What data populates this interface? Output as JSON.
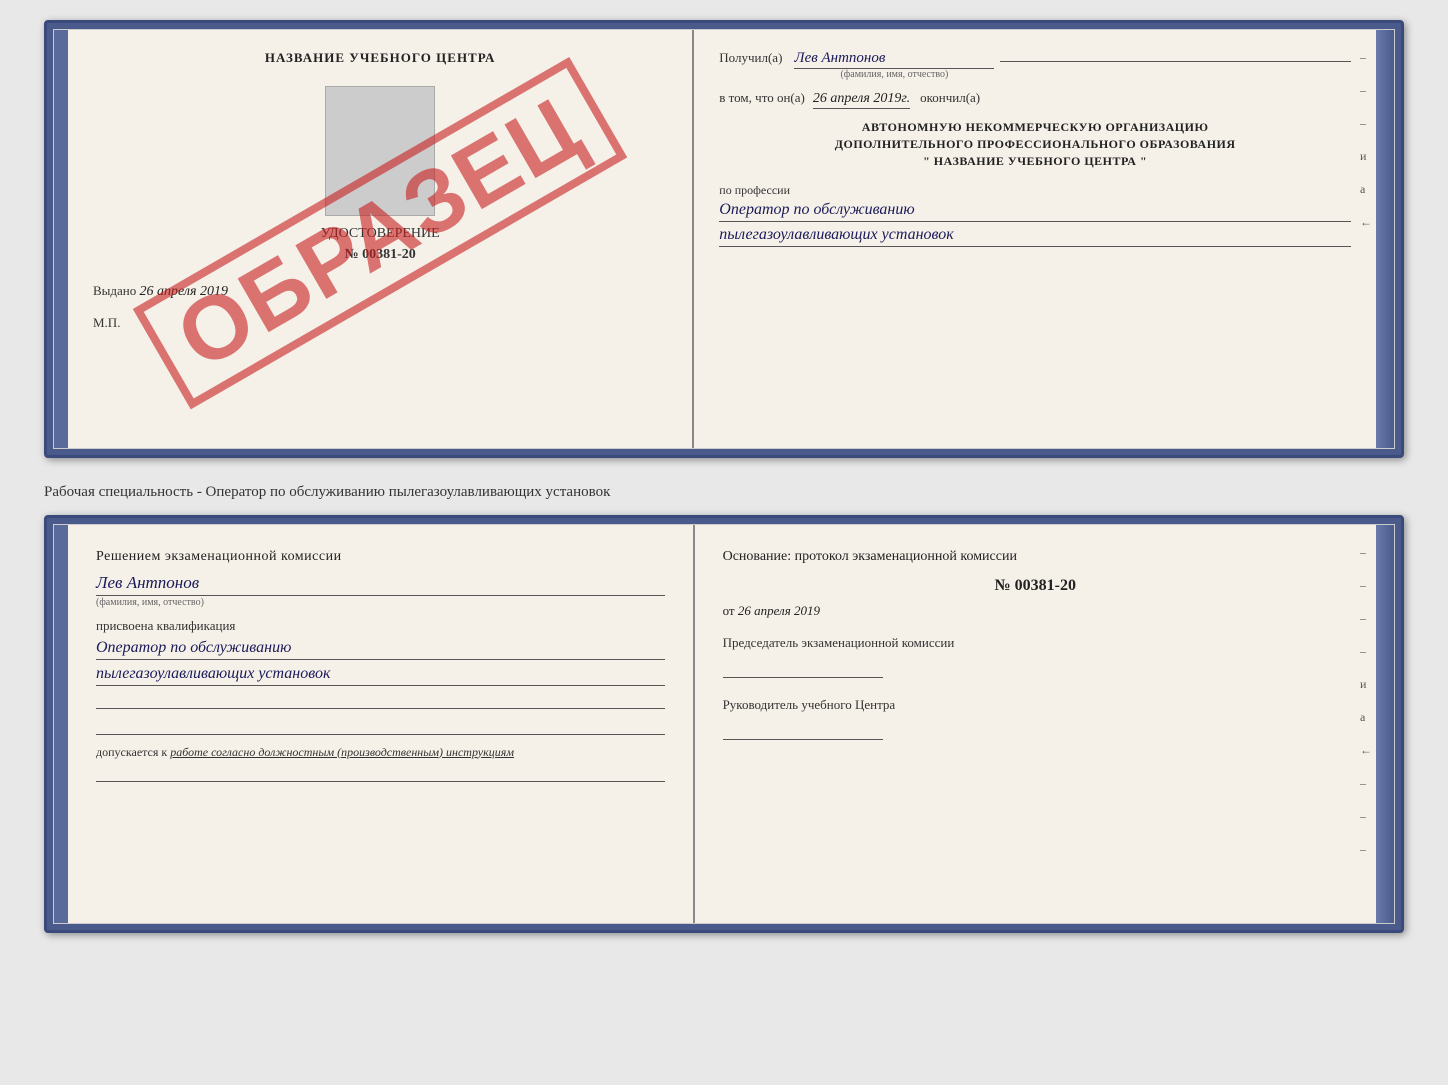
{
  "top_cert": {
    "left": {
      "title": "НАЗВАНИЕ УЧЕБНОГО ЦЕНТРА",
      "doc_type": "УДОСТОВЕРЕНИЕ",
      "doc_number": "№ 00381-20",
      "issued_label": "Выдано",
      "issued_date": "26 апреля 2019",
      "mp_label": "М.П.",
      "watermark": "ОБРАЗЕЦ"
    },
    "right": {
      "received_label": "Получил(а)",
      "received_name": "Лев Антпонов",
      "received_subtext": "(фамилия, имя, отчество)",
      "completed_prefix": "в том, что он(а)",
      "completed_date": "26 апреля 2019г.",
      "completed_suffix": "окончил(а)",
      "org_line1": "АВТОНОМНУЮ НЕКОММЕРЧЕСКУЮ ОРГАНИЗАЦИЮ",
      "org_line2": "ДОПОЛНИТЕЛЬНОГО ПРОФЕССИОНАЛЬНОГО ОБРАЗОВАНИЯ",
      "org_line3": "\"   НАЗВАНИЕ УЧЕБНОГО ЦЕНТРА   \"",
      "profession_label": "по профессии",
      "profession_line1": "Оператор по обслуживанию",
      "profession_line2": "пылегазоулавливающих установок"
    }
  },
  "between_text": "Рабочая специальность - Оператор по обслуживанию пылегазоулавливающих установок",
  "bottom_cert": {
    "left": {
      "decision_text": "Решением экзаменационной комиссии",
      "person_name": "Лев Антпонов",
      "person_subtext": "(фамилия, имя, отчество)",
      "assigned_label": "присвоена квалификация",
      "qualification_line1": "Оператор по обслуживанию",
      "qualification_line2": "пылегазоулавливающих установок",
      "допускается_label": "допускается к",
      "допускается_value": "работе согласно должностным (производственным) инструкциям"
    },
    "right": {
      "basis_label": "Основание: протокол экзаменационной комиссии",
      "protocol_number": "№ 00381-20",
      "protocol_date_prefix": "от",
      "protocol_date": "26 апреля 2019",
      "chairman_label": "Председатель экзаменационной комиссии",
      "leader_label": "Руководитель учебного Центра"
    }
  },
  "side_marks_top": [
    "–",
    "–",
    "–",
    "и",
    "а",
    "←"
  ],
  "side_marks_bottom": [
    "–",
    "–",
    "–",
    "–",
    "и",
    "а",
    "←",
    "–",
    "–",
    "–"
  ]
}
